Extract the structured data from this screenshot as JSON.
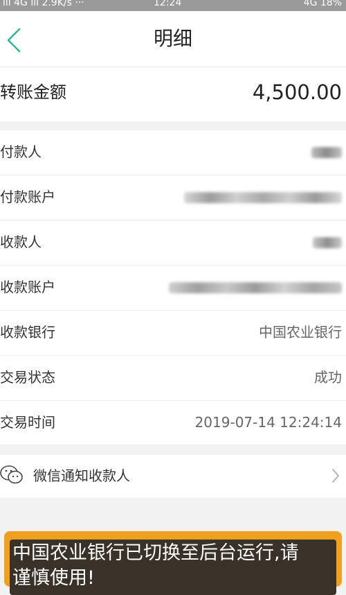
{
  "status_bar": {
    "left": "ıll 4G ıll 2.9K/s ···",
    "time": "12:24",
    "right": "4G 18%"
  },
  "header": {
    "title": "明细"
  },
  "amount": {
    "label": "转账金额",
    "value": "4,500.00"
  },
  "details": [
    {
      "label": "付款人",
      "value": "",
      "blurred": true
    },
    {
      "label": "付款账户",
      "value": "",
      "blurred": true
    },
    {
      "label": "收款人",
      "value": "",
      "blurred": true
    },
    {
      "label": "收款账户",
      "value": "",
      "blurred": true
    },
    {
      "label": "收款银行",
      "value": "中国农业银行",
      "blurred": false
    },
    {
      "label": "交易状态",
      "value": "成功",
      "blurred": false
    },
    {
      "label": "交易时间",
      "value": "2019-07-14 12:24:14",
      "blurred": false
    }
  ],
  "wechat": {
    "label": "微信通知收款人"
  },
  "toast": {
    "text": "中国农业银行已切换至后台运行,请谨慎使用!"
  },
  "colors": {
    "accent": "#2bb3a3",
    "toast_border": "#f0a01f",
    "toast_bg": "#3a3128"
  }
}
